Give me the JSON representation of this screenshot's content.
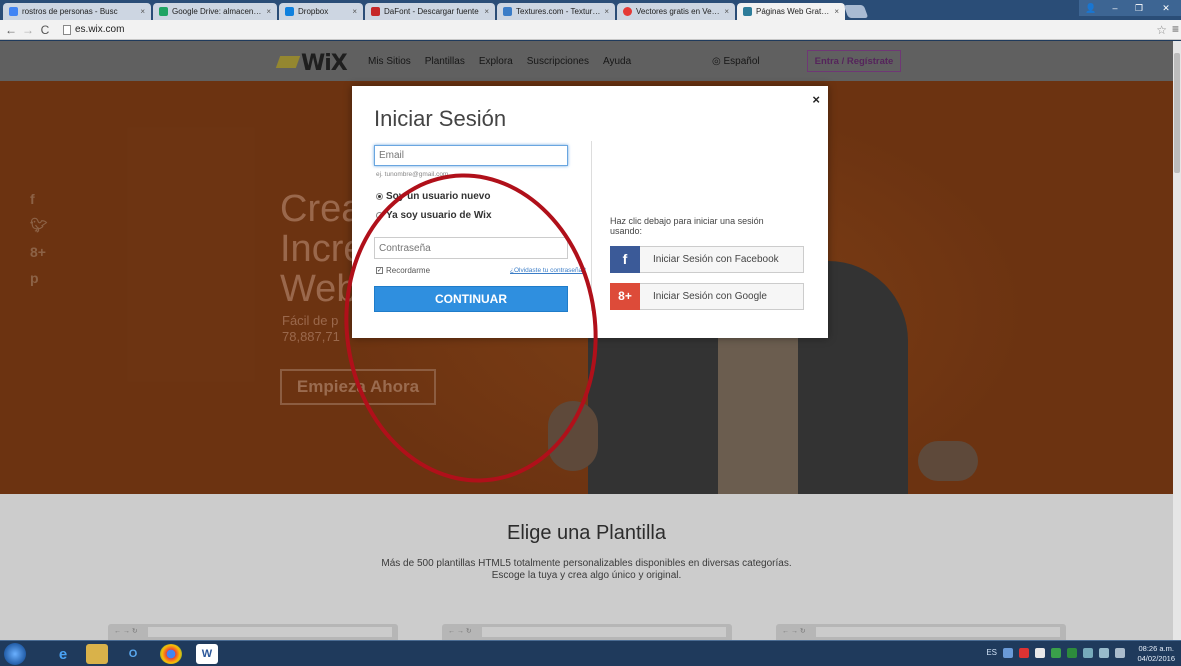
{
  "tabs": [
    {
      "label": "rostros de personas - Busc",
      "color": "#4285f4"
    },
    {
      "label": "Google Drive: almacenami",
      "color": "#1fa463"
    },
    {
      "label": "Dropbox",
      "color": "#1081de"
    },
    {
      "label": "DaFont - Descargar fuente",
      "color": "#c62828"
    },
    {
      "label": "Textures.com - Textures fo",
      "color": "#3b7dc7"
    },
    {
      "label": "Vectores gratis en Vector",
      "color": "#e53935"
    },
    {
      "label": "Páginas Web Gratis | Des",
      "color": "#2e7d9a"
    }
  ],
  "address": {
    "url": "es.wix.com"
  },
  "wix": {
    "nav": [
      "Mis Sitios",
      "Plantillas",
      "Explora",
      "Suscripciones",
      "Ayuda"
    ],
    "language": "◎ Español",
    "login_button": "Entra / Regístrate"
  },
  "hero": {
    "title_line1": "Crea",
    "title_line2": "Incre",
    "title_line3": "Web",
    "sub_line1": "Fácil de p",
    "sub_line2": "78,887,71",
    "cta": "Empieza Ahora"
  },
  "social_icons": [
    "f",
    "t",
    "8+",
    "p"
  ],
  "modal": {
    "title": "Iniciar Sesión",
    "close": "×",
    "email_placeholder": "Email",
    "email_hint": "ej. tunombre@gmail.com",
    "radio_new": "Soy un usuario nuevo",
    "radio_existing": "Ya soy usuario de Wix",
    "password_placeholder": "Contraseña",
    "remember": "Recordarme",
    "forgot": "¿Olvidaste tu contraseña?",
    "continue": "CONTINUAR",
    "social_hint": "Haz clic debajo para iniciar una sesión usando:",
    "facebook": "Iniciar Sesión con Facebook",
    "google": "Iniciar Sesión con Google"
  },
  "templates": {
    "title": "Elige una Plantilla",
    "desc_line1": "Más de 500 plantillas HTML5 totalmente personalizables disponibles en diversas categorías.",
    "desc_line2": "Escoge la tuya y crea algo único y original."
  },
  "taskbar": {
    "lang": "ES",
    "time": "08:26 a.m.",
    "date": "04/02/2016"
  },
  "colors": {
    "accent_blue": "#2f8fdf",
    "facebook": "#3b5a98",
    "google": "#dd4b39",
    "annotation_red": "#b0101a",
    "hero_orange": "#7c3b14"
  }
}
